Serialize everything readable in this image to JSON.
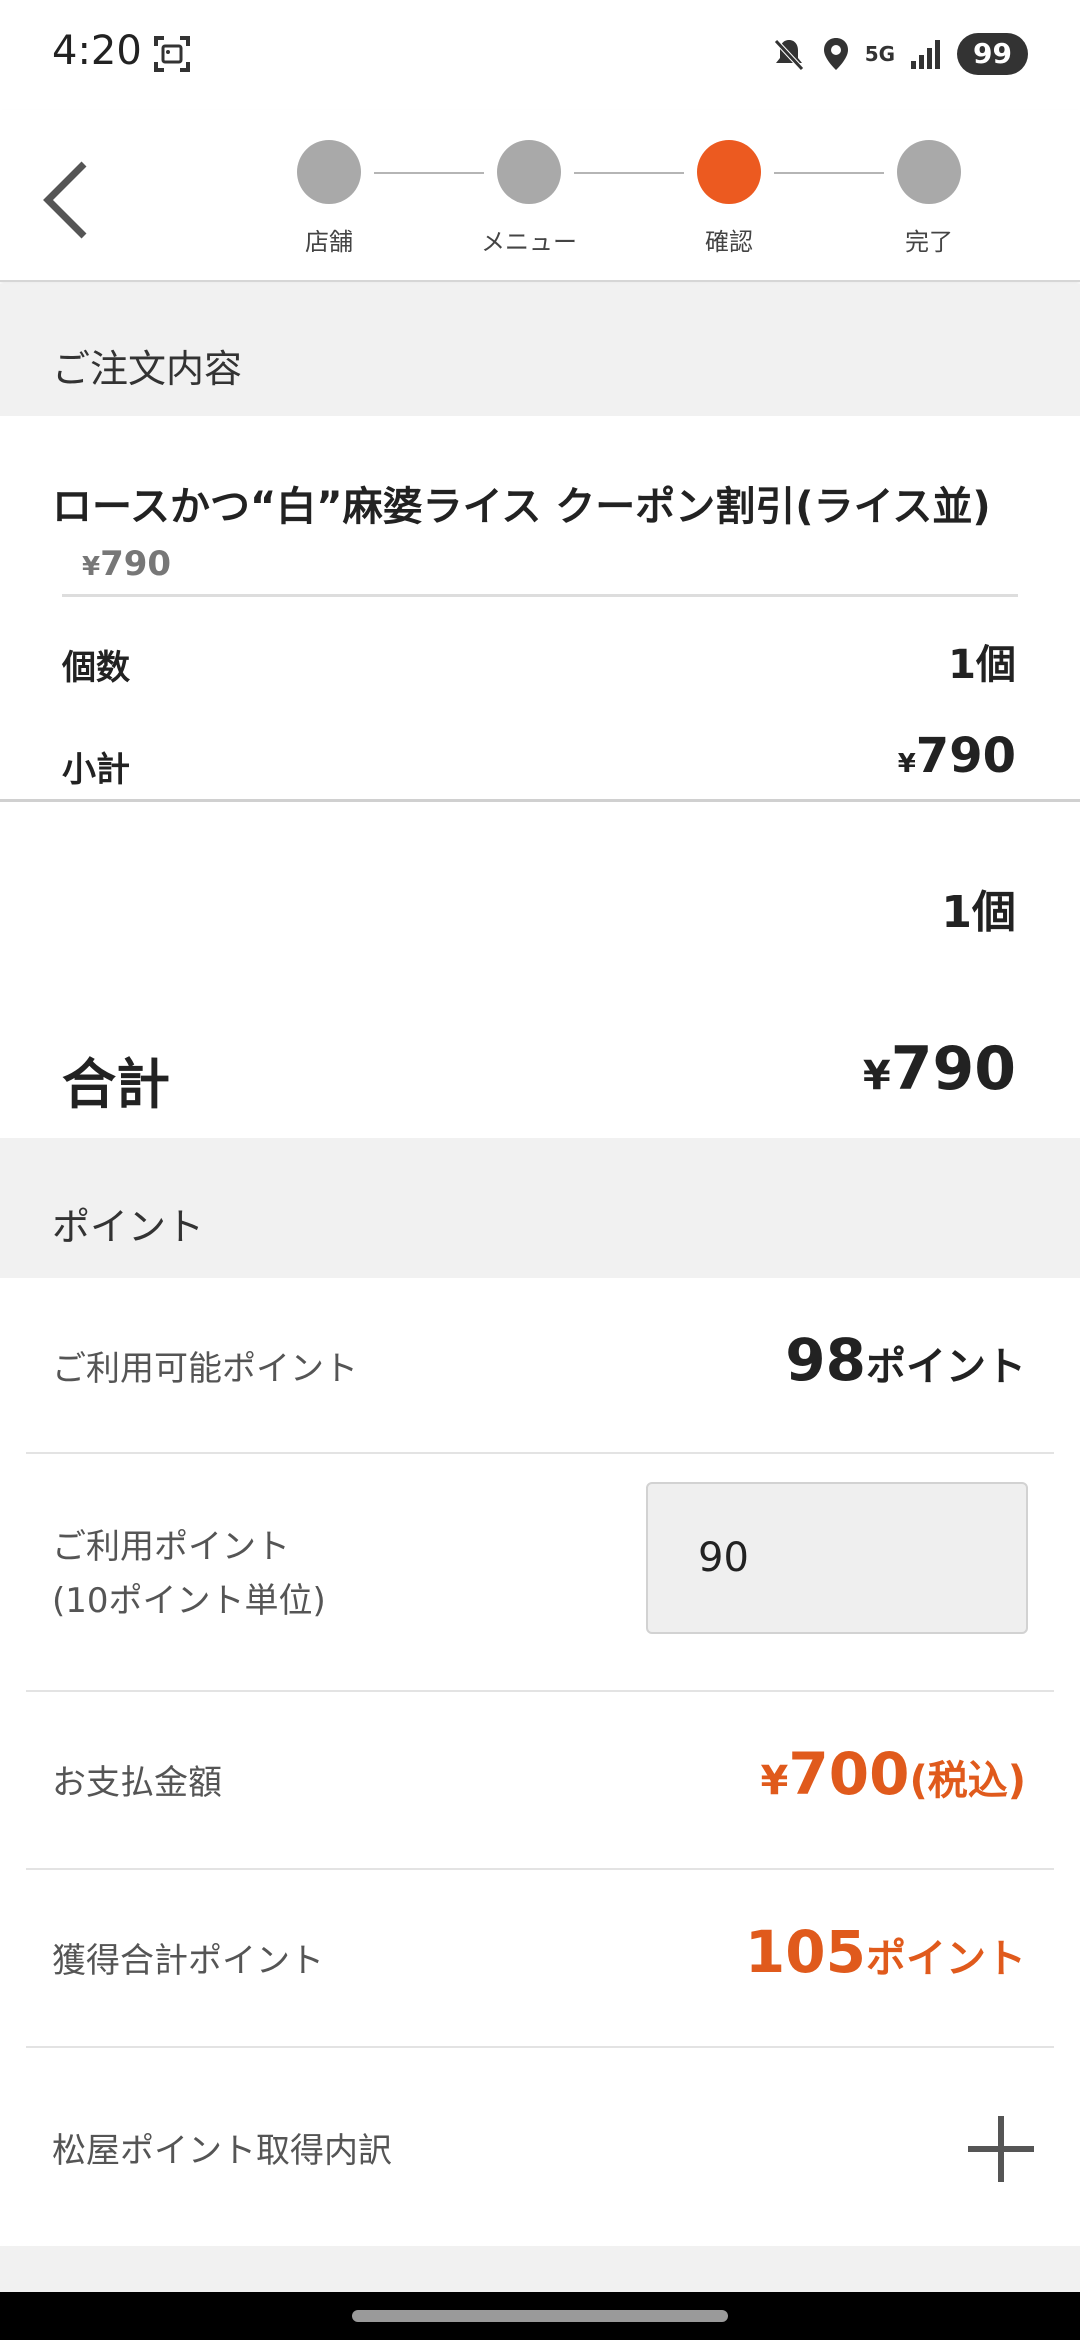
{
  "status": {
    "time": "4:20",
    "network": "5G",
    "battery": "99"
  },
  "stepper": {
    "steps": [
      {
        "label": "店舗",
        "active": false
      },
      {
        "label": "メニュー",
        "active": false
      },
      {
        "label": "確認",
        "active": true
      },
      {
        "label": "完了",
        "active": false
      }
    ],
    "active_color": "#ec5a20",
    "inactive_color": "#a9a9a9"
  },
  "order": {
    "section_title": "ご注文内容",
    "item": {
      "name": "ロースかつ“白”麻婆ライス クーポン割引(ライス並)",
      "price_yen": "¥",
      "price": "790"
    },
    "quantity_label": "個数",
    "quantity_value": "1個",
    "subtotal_label": "小計",
    "subtotal_yen": "¥",
    "subtotal_value": "790",
    "total_quantity": "1個",
    "total_label": "合計",
    "total_yen": "¥",
    "total_value": "790"
  },
  "points": {
    "section_title": "ポイント",
    "available_label": "ご利用可能ポイント",
    "available_value": "98",
    "available_unit": "ポイント",
    "use_label_line1": "ご利用ポイント",
    "use_label_line2": "(10ポイント単位)",
    "use_input_value": "90",
    "payment_label": "お支払金額",
    "payment_yen": "¥",
    "payment_value": "700",
    "payment_suffix": "(税込)",
    "earned_label": "獲得合計ポイント",
    "earned_value": "105",
    "earned_unit": "ポイント",
    "breakdown_label": "松屋ポイント取得内訳"
  },
  "colors": {
    "accent": "#e05a1c",
    "section_bg": "#f1f1f1"
  }
}
